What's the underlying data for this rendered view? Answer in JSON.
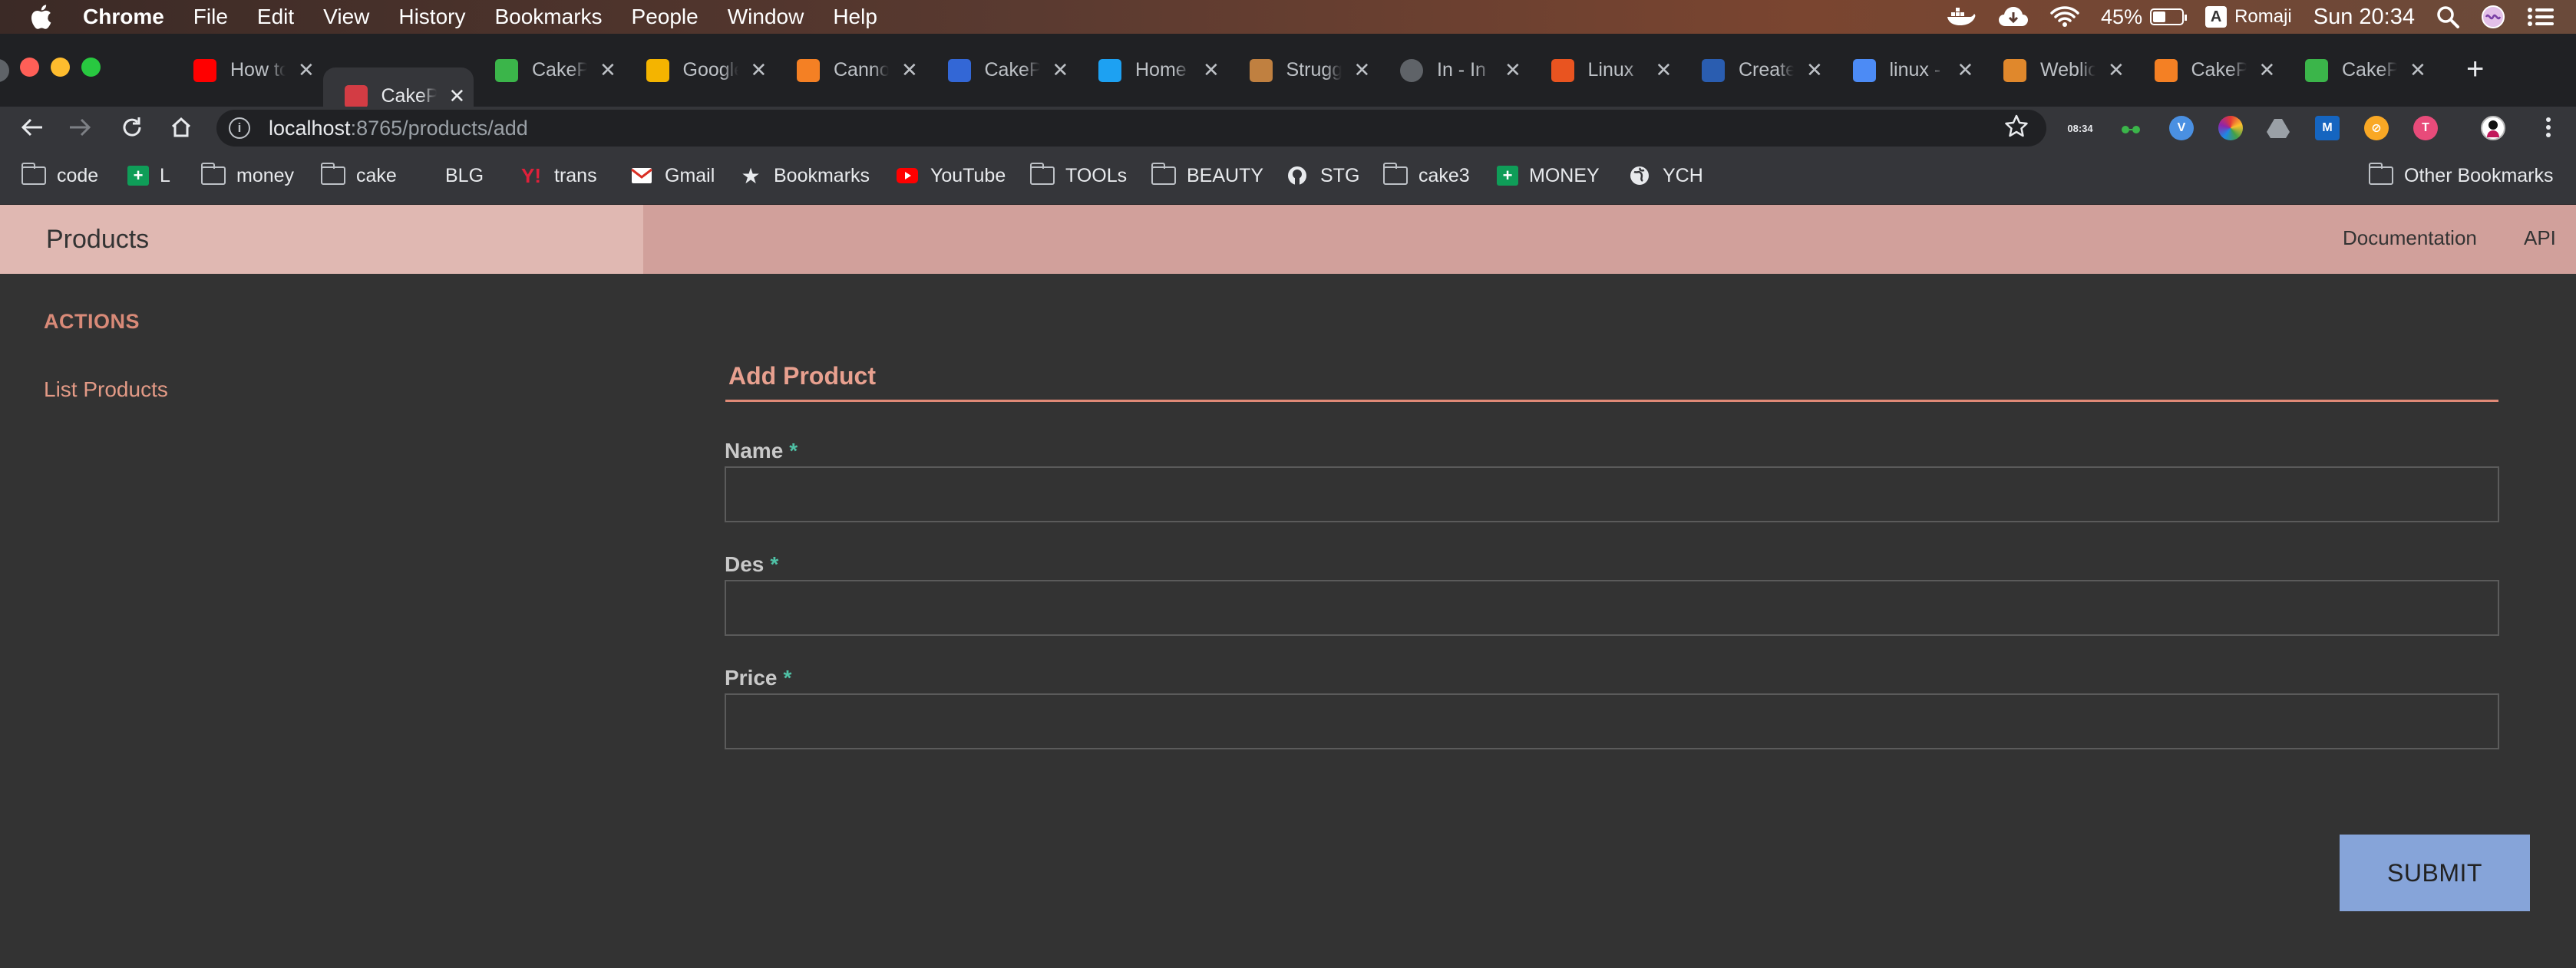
{
  "menubar": {
    "app_name": "Chrome",
    "items": [
      "File",
      "Edit",
      "View",
      "History",
      "Bookmarks",
      "People",
      "Window",
      "Help"
    ],
    "battery_percent": "45%",
    "battery_level": 0.45,
    "input_source": "Romaji",
    "input_source_letter": "A",
    "clock": "Sun 20:34"
  },
  "tabs": [
    {
      "title": "",
      "icon": "github-icon",
      "color": "#5f6368"
    },
    {
      "title": "How to",
      "icon": "youtube-icon",
      "color": "#ff0000"
    },
    {
      "title": "CakePHP",
      "icon": "cakephp-icon",
      "color": "#d33c44",
      "active": true
    },
    {
      "title": "CakePHP",
      "icon": "qlist-icon",
      "color": "#3bb54a"
    },
    {
      "title": "Google",
      "icon": "lightbulb-icon",
      "color": "#f4b400"
    },
    {
      "title": "Cannot",
      "icon": "stackoverflow-icon",
      "color": "#f48024"
    },
    {
      "title": "CakePHP",
      "icon": "flask-icon",
      "color": "#3367d6"
    },
    {
      "title": "Home",
      "icon": "twitter-icon",
      "color": "#1da1f2"
    },
    {
      "title": "Struggle",
      "icon": "image-icon",
      "color": "#c08040"
    },
    {
      "title": "In - In",
      "icon": "globe-icon",
      "color": "#5f6368"
    },
    {
      "title": "Linux",
      "icon": "ubuntu-icon",
      "color": "#e95420"
    },
    {
      "title": "Create",
      "icon": "faq-icon",
      "color": "#2a5db0"
    },
    {
      "title": "linux -",
      "icon": "brace-icon",
      "color": "#4c8bf5"
    },
    {
      "title": "Weblio",
      "icon": "weblio-icon",
      "color": "#e0882c"
    },
    {
      "title": "CakePHP",
      "icon": "stackoverflow-icon",
      "color": "#f48024"
    },
    {
      "title": "CakePHP",
      "icon": "qlist-icon",
      "color": "#3bb54a"
    }
  ],
  "omnibox": {
    "host": "localhost",
    "path": ":8765/products/add"
  },
  "extension_clock": "08:34",
  "bookmarks": [
    {
      "label": "code",
      "icon": "folder-icon"
    },
    {
      "label": "L",
      "icon": "sheets-icon"
    },
    {
      "label": "money",
      "icon": "folder-icon"
    },
    {
      "label": "cake",
      "icon": "folder-icon"
    },
    {
      "label": "BLG",
      "icon": "blank-icon"
    },
    {
      "label": "trans",
      "icon": "yahoo-icon"
    },
    {
      "label": "Gmail",
      "icon": "gmail-icon"
    },
    {
      "label": "Bookmarks",
      "icon": "star-icon"
    },
    {
      "label": "YouTube",
      "icon": "youtube-icon"
    },
    {
      "label": "TOOLs",
      "icon": "folder-icon"
    },
    {
      "label": "BEAUTY",
      "icon": "folder-icon"
    },
    {
      "label": "STG",
      "icon": "github-icon"
    },
    {
      "label": "cake3",
      "icon": "folder-icon"
    },
    {
      "label": "MONEY",
      "icon": "sheets-icon"
    },
    {
      "label": "YCH",
      "icon": "globe-icon"
    }
  ],
  "other_bookmarks": "Other Bookmarks",
  "app": {
    "brand": "Products",
    "top_links": [
      "Documentation",
      "API"
    ],
    "sidebar_heading": "ACTIONS",
    "sidebar_link": "List Products",
    "form_legend": "Add Product",
    "fields": [
      {
        "label": "Name",
        "required": "*",
        "value": ""
      },
      {
        "label": "Des",
        "required": "*",
        "value": ""
      },
      {
        "label": "Price",
        "required": "*",
        "value": ""
      }
    ],
    "submit_label": "SUBMIT"
  }
}
